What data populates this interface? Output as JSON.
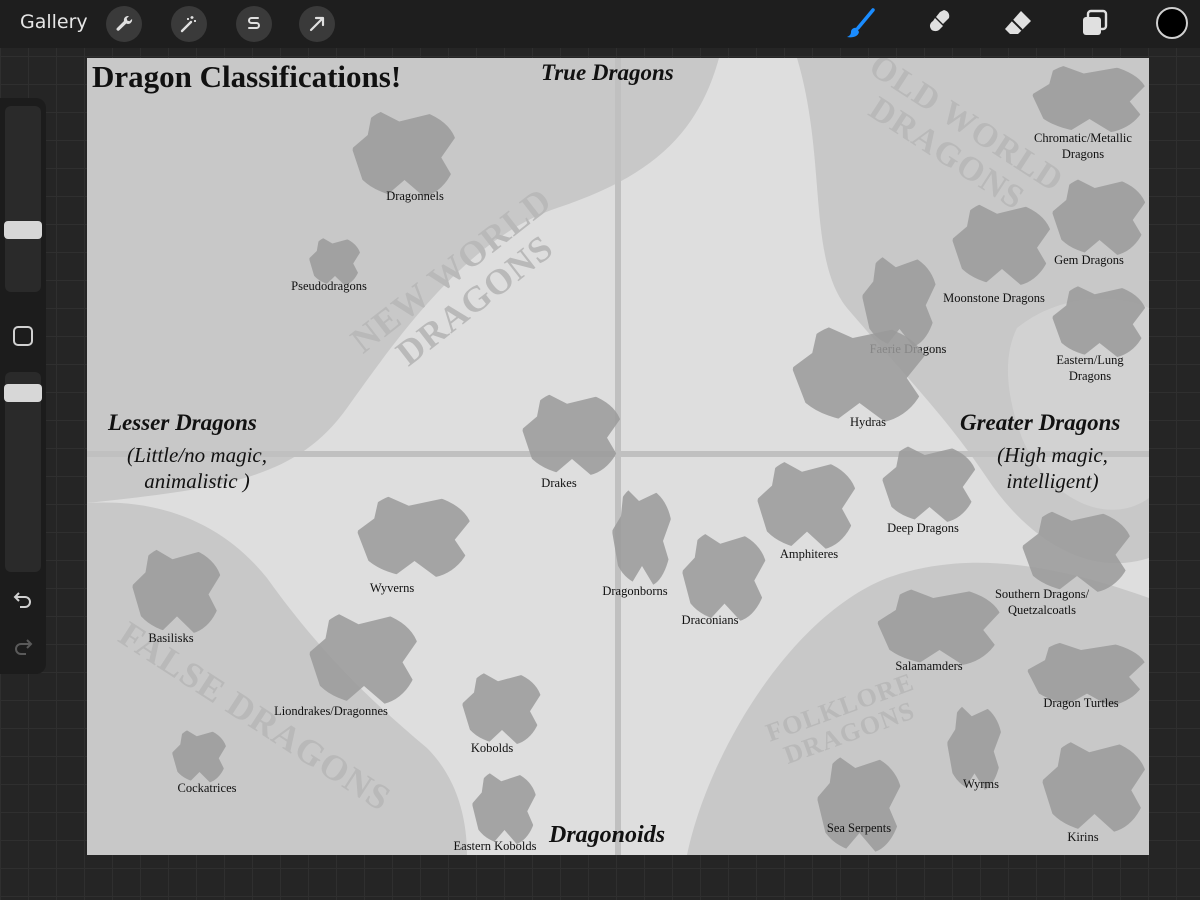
{
  "toolbar": {
    "gallery_label": "Gallery",
    "left_tools": [
      "wrench-icon",
      "magic-wand-icon",
      "selection-s-icon",
      "transform-arrow-icon"
    ],
    "right_tools": [
      "brush-icon",
      "smudge-icon",
      "eraser-icon",
      "layers-icon"
    ],
    "active_tool": "brush-icon",
    "accent_color": "#1a8cff",
    "current_color": "#000000"
  },
  "sidebar": {
    "icons": [
      "modify-square-icon",
      "undo-icon",
      "redo-icon"
    ]
  },
  "chart": {
    "title": "Dragon Classifications!",
    "top_axis": "True Dragons",
    "bottom_axis": "Dragonoids",
    "left_axis": "Lesser Dragons",
    "left_sub_1": "(Little/no magic,",
    "left_sub_2": "animalistic )",
    "right_axis": "Greater Dragons",
    "right_sub_1": "(High magic,",
    "right_sub_2": "intelligent)",
    "regions": {
      "new_world": [
        "NEW WORLD",
        "DRAGONS"
      ],
      "old_world": [
        "OLD WORLD",
        "DRAGONS"
      ],
      "false": [
        "FALSE DRAGONS"
      ],
      "folklore": [
        "FOLKLORE",
        "DRAGONS"
      ]
    },
    "creatures": [
      {
        "lines": [
          "Dragonnels"
        ]
      },
      {
        "lines": [
          "Pseudodragons"
        ]
      },
      {
        "lines": [
          "Chromatic/Metallic",
          "Dragons"
        ]
      },
      {
        "lines": [
          "Gem Dragons"
        ]
      },
      {
        "lines": [
          "Moonstone Dragons"
        ]
      },
      {
        "lines": [
          "Faerie Dragons"
        ]
      },
      {
        "lines": [
          "Eastern/Lung",
          "Dragons"
        ]
      },
      {
        "lines": [
          "Hydras"
        ]
      },
      {
        "lines": [
          "Drakes"
        ]
      },
      {
        "lines": [
          "Deep Dragons"
        ]
      },
      {
        "lines": [
          "Amphiteres"
        ]
      },
      {
        "lines": [
          "Wyverns"
        ]
      },
      {
        "lines": [
          "Basilisks"
        ]
      },
      {
        "lines": [
          "Dragonborns"
        ]
      },
      {
        "lines": [
          "Draconians"
        ]
      },
      {
        "lines": [
          "Southern Dragons/",
          "Quetzalcoatls"
        ]
      },
      {
        "lines": [
          "Salamamders"
        ]
      },
      {
        "lines": [
          "Liondrakes/Dragonnes"
        ]
      },
      {
        "lines": [
          "Kobolds"
        ]
      },
      {
        "lines": [
          "Dragon Turtles"
        ]
      },
      {
        "lines": [
          "Cockatrices"
        ]
      },
      {
        "lines": [
          "Wyrms"
        ]
      },
      {
        "lines": [
          "Eastern Kobolds"
        ]
      },
      {
        "lines": [
          "Sea Serpents"
        ]
      },
      {
        "lines": [
          "Kirins"
        ]
      }
    ]
  }
}
